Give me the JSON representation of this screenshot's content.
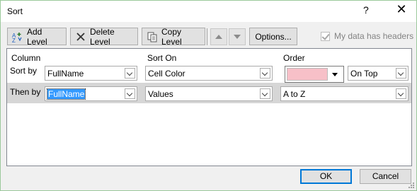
{
  "dialog": {
    "title": "Sort",
    "help": "?",
    "close": "✕"
  },
  "toolbar": {
    "add_level": "Add Level",
    "delete_level": "Delete Level",
    "copy_level": "Copy Level",
    "options": "Options...",
    "has_headers_label": "My data has headers",
    "has_headers_checked": true,
    "has_headers_enabled": false
  },
  "grid": {
    "headers": {
      "column": "Column",
      "sort_on": "Sort On",
      "order": "Order"
    },
    "rows": [
      {
        "label": "Sort by",
        "column": "FullName",
        "sort_on": "Cell Color",
        "order_color": "#f7c0c8",
        "position": "On Top"
      },
      {
        "label": "Then by",
        "column": "FullName",
        "sort_on": "Values",
        "order": "A to Z"
      }
    ]
  },
  "footer": {
    "ok": "OK",
    "cancel": "Cancel"
  },
  "colors": {
    "selected_row": "#d6d6d6",
    "ok_border": "#0078d7",
    "swatch": "#f7c0c8"
  }
}
